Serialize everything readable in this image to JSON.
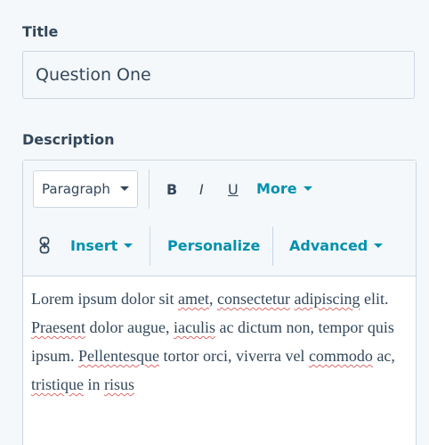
{
  "title_field": {
    "label": "Title",
    "value": "Question One"
  },
  "description_field": {
    "label": "Description",
    "toolbar": {
      "paragraph_select": "Paragraph",
      "bold": "B",
      "italic": "I",
      "underline": "U",
      "more": "More",
      "insert": "Insert",
      "personalize": "Personalize",
      "advanced": "Advanced"
    },
    "content": {
      "s1": "Lorem ipsum dolor sit ",
      "s2": "amet",
      "s3": ", ",
      "s4": "consectetur",
      "s5": " ",
      "s6": "adipiscing",
      "s7": " elit. ",
      "s8": "Praesent",
      "s9": " dolor augue, ",
      "s10": "iaculis",
      "s11": " ac dictum non, tempor quis ipsum. ",
      "s12": "Pellentesque",
      "s13": " tortor orci, viverra vel ",
      "s14": "commodo",
      "s15": " ac, ",
      "s16": "tristique",
      "s17": " in ",
      "s18": "risus"
    }
  },
  "colors": {
    "accent": "#0091ae",
    "text": "#33475b",
    "border": "#cbd6e2",
    "background": "#f5f8fa",
    "spellcheck": "#e06a6a"
  }
}
